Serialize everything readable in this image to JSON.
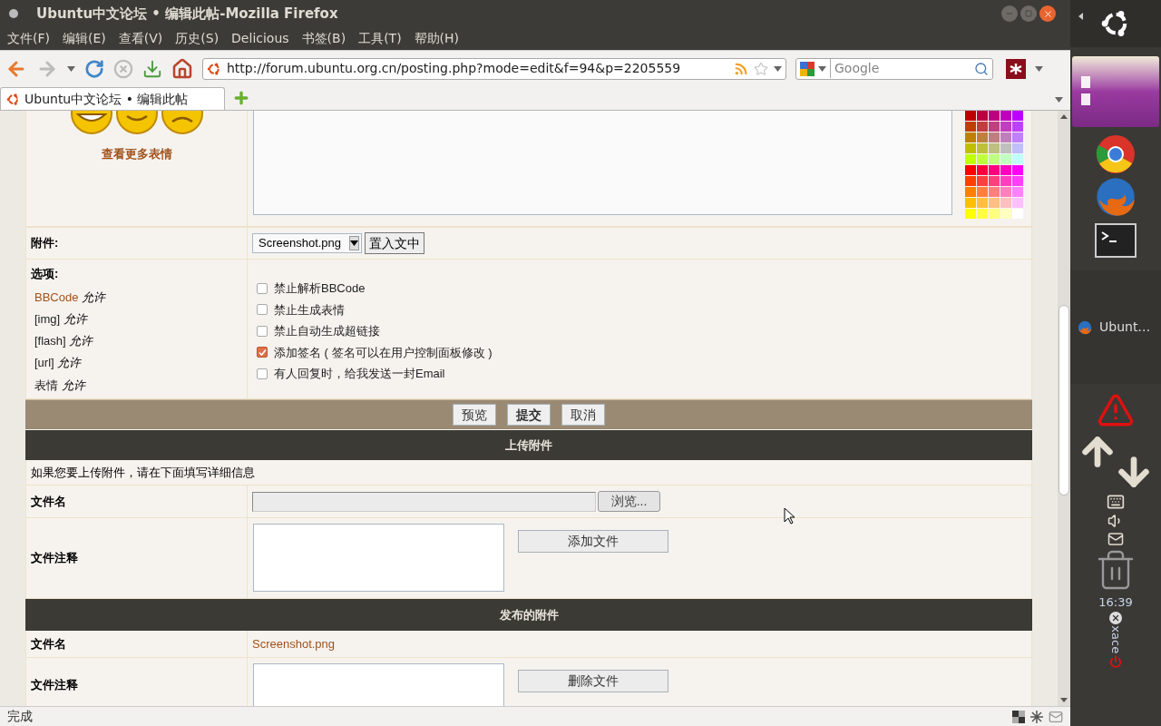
{
  "window": {
    "title": "Ubuntu中文论坛 • 编辑此帖-Mozilla Firefox"
  },
  "menu_bar": [
    "文件(F)",
    "编辑(E)",
    "查看(V)",
    "历史(S)",
    "Delicious",
    "书签(B)",
    "工具(T)",
    "帮助(H)"
  ],
  "toolbar": {
    "url": "http://forum.ubuntu.org.cn/posting.php?mode=edit&f=94&p=2205559",
    "search_placeholder": "Google"
  },
  "tabs": [
    {
      "label": "Ubuntu中文论坛 • 编辑此帖",
      "selected": true
    }
  ],
  "smilies_panel": {
    "link": "查看更多表情"
  },
  "attachment_row": {
    "label": "附件:",
    "select_value": "Screenshot.png",
    "button": "置入文中"
  },
  "options": {
    "label": "选项:",
    "permissions": [
      {
        "name": "BBCode",
        "value": "允许",
        "linked": true
      },
      {
        "name": "[img]",
        "value": "允许",
        "linked": false
      },
      {
        "name": "[flash]",
        "value": "允许",
        "linked": false
      },
      {
        "name": "[url]",
        "value": "允许",
        "linked": false
      },
      {
        "name": "表情",
        "value": "允许",
        "linked": false
      }
    ],
    "checkboxes": [
      {
        "label": "禁止解析BBCode",
        "checked": false
      },
      {
        "label": "禁止生成表情",
        "checked": false
      },
      {
        "label": "禁止自动生成超链接",
        "checked": false
      },
      {
        "label": "添加签名 ( 签名可以在用户控制面板修改 )",
        "checked": true
      },
      {
        "label": "有人回复时，给我发送一封Email",
        "checked": false
      }
    ]
  },
  "action_buttons": [
    {
      "label": "预览",
      "primary": false
    },
    {
      "label": "提交",
      "primary": true
    },
    {
      "label": "取消",
      "primary": false
    }
  ],
  "upload_section": {
    "title": "上传附件",
    "hint": "如果您要上传附件，请在下面填写详细信息",
    "filename_label": "文件名",
    "browse_button": "浏览...",
    "comment_label": "文件注释",
    "add_button": "添加文件"
  },
  "posted_section": {
    "title": "发布的附件",
    "filename_label": "文件名",
    "filename": "Screenshot.png",
    "comment_label": "文件注释",
    "delete_button": "删除文件"
  },
  "status_bar": {
    "text": "完成"
  },
  "launcher": {
    "window_item": "Ubunt…",
    "clock": "16:39",
    "applet": "xace"
  }
}
